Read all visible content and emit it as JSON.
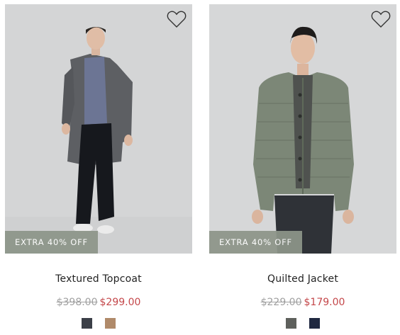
{
  "products": [
    {
      "badge": "EXTRA 40% OFF",
      "name": "Textured Topcoat",
      "was_price": "$398.00",
      "sale_price": "$299.00",
      "swatches": [
        {
          "name": "charcoal",
          "color": "#3b3f47"
        },
        {
          "name": "camel",
          "color": "#b08a6a"
        }
      ]
    },
    {
      "badge": "EXTRA 40% OFF",
      "name": "Quilted Jacket",
      "was_price": "$229.00",
      "sale_price": "$179.00",
      "swatches": [
        {
          "name": "olive-grey",
          "color": "#5e605c"
        },
        {
          "name": "navy",
          "color": "#1f2840"
        }
      ]
    }
  ],
  "icons": {
    "wishlist": "heart-outline-icon"
  },
  "colors": {
    "badge_bg": "#8d9589",
    "sale_price": "#c4474a",
    "was_price": "#a0a0a0"
  }
}
